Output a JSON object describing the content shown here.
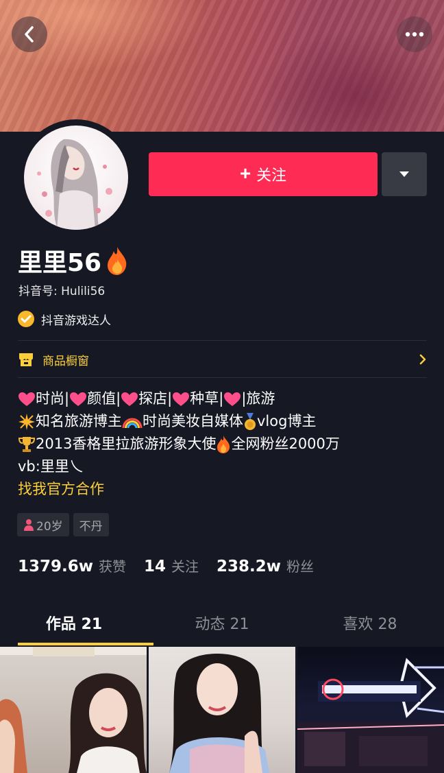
{
  "profile": {
    "nickname": "里里56",
    "douyin_id": "抖音号: Hulili56",
    "verified_label": "抖音游戏达人"
  },
  "actions": {
    "follow_label": "关注"
  },
  "shop": {
    "label": "商品橱窗"
  },
  "bio": {
    "line1": [
      "时尚|",
      "颜值|",
      "探店|",
      "种草|",
      "|旅游"
    ],
    "line2": [
      "知名旅游博主",
      "时尚美妆自媒体",
      "vlog博主"
    ],
    "line3": [
      "2013香格里拉旅游形象大使",
      "全网粉丝2000万"
    ],
    "line4": "vb:里里乀",
    "link": "找我官方合作"
  },
  "tags": {
    "age": "20岁",
    "location": "不丹"
  },
  "stats": {
    "likes_num": "1379.6w",
    "likes_label": "获赞",
    "following_num": "14",
    "following_label": "关注",
    "followers_num": "238.2w",
    "followers_label": "粉丝"
  },
  "tabs": {
    "works": "作品 21",
    "dynamic": "动态 21",
    "likes": "喜欢 28"
  },
  "colors": {
    "background": "#161823",
    "follow": "#fe2c55",
    "accent": "#facf3b",
    "muted": "#8f9096"
  }
}
